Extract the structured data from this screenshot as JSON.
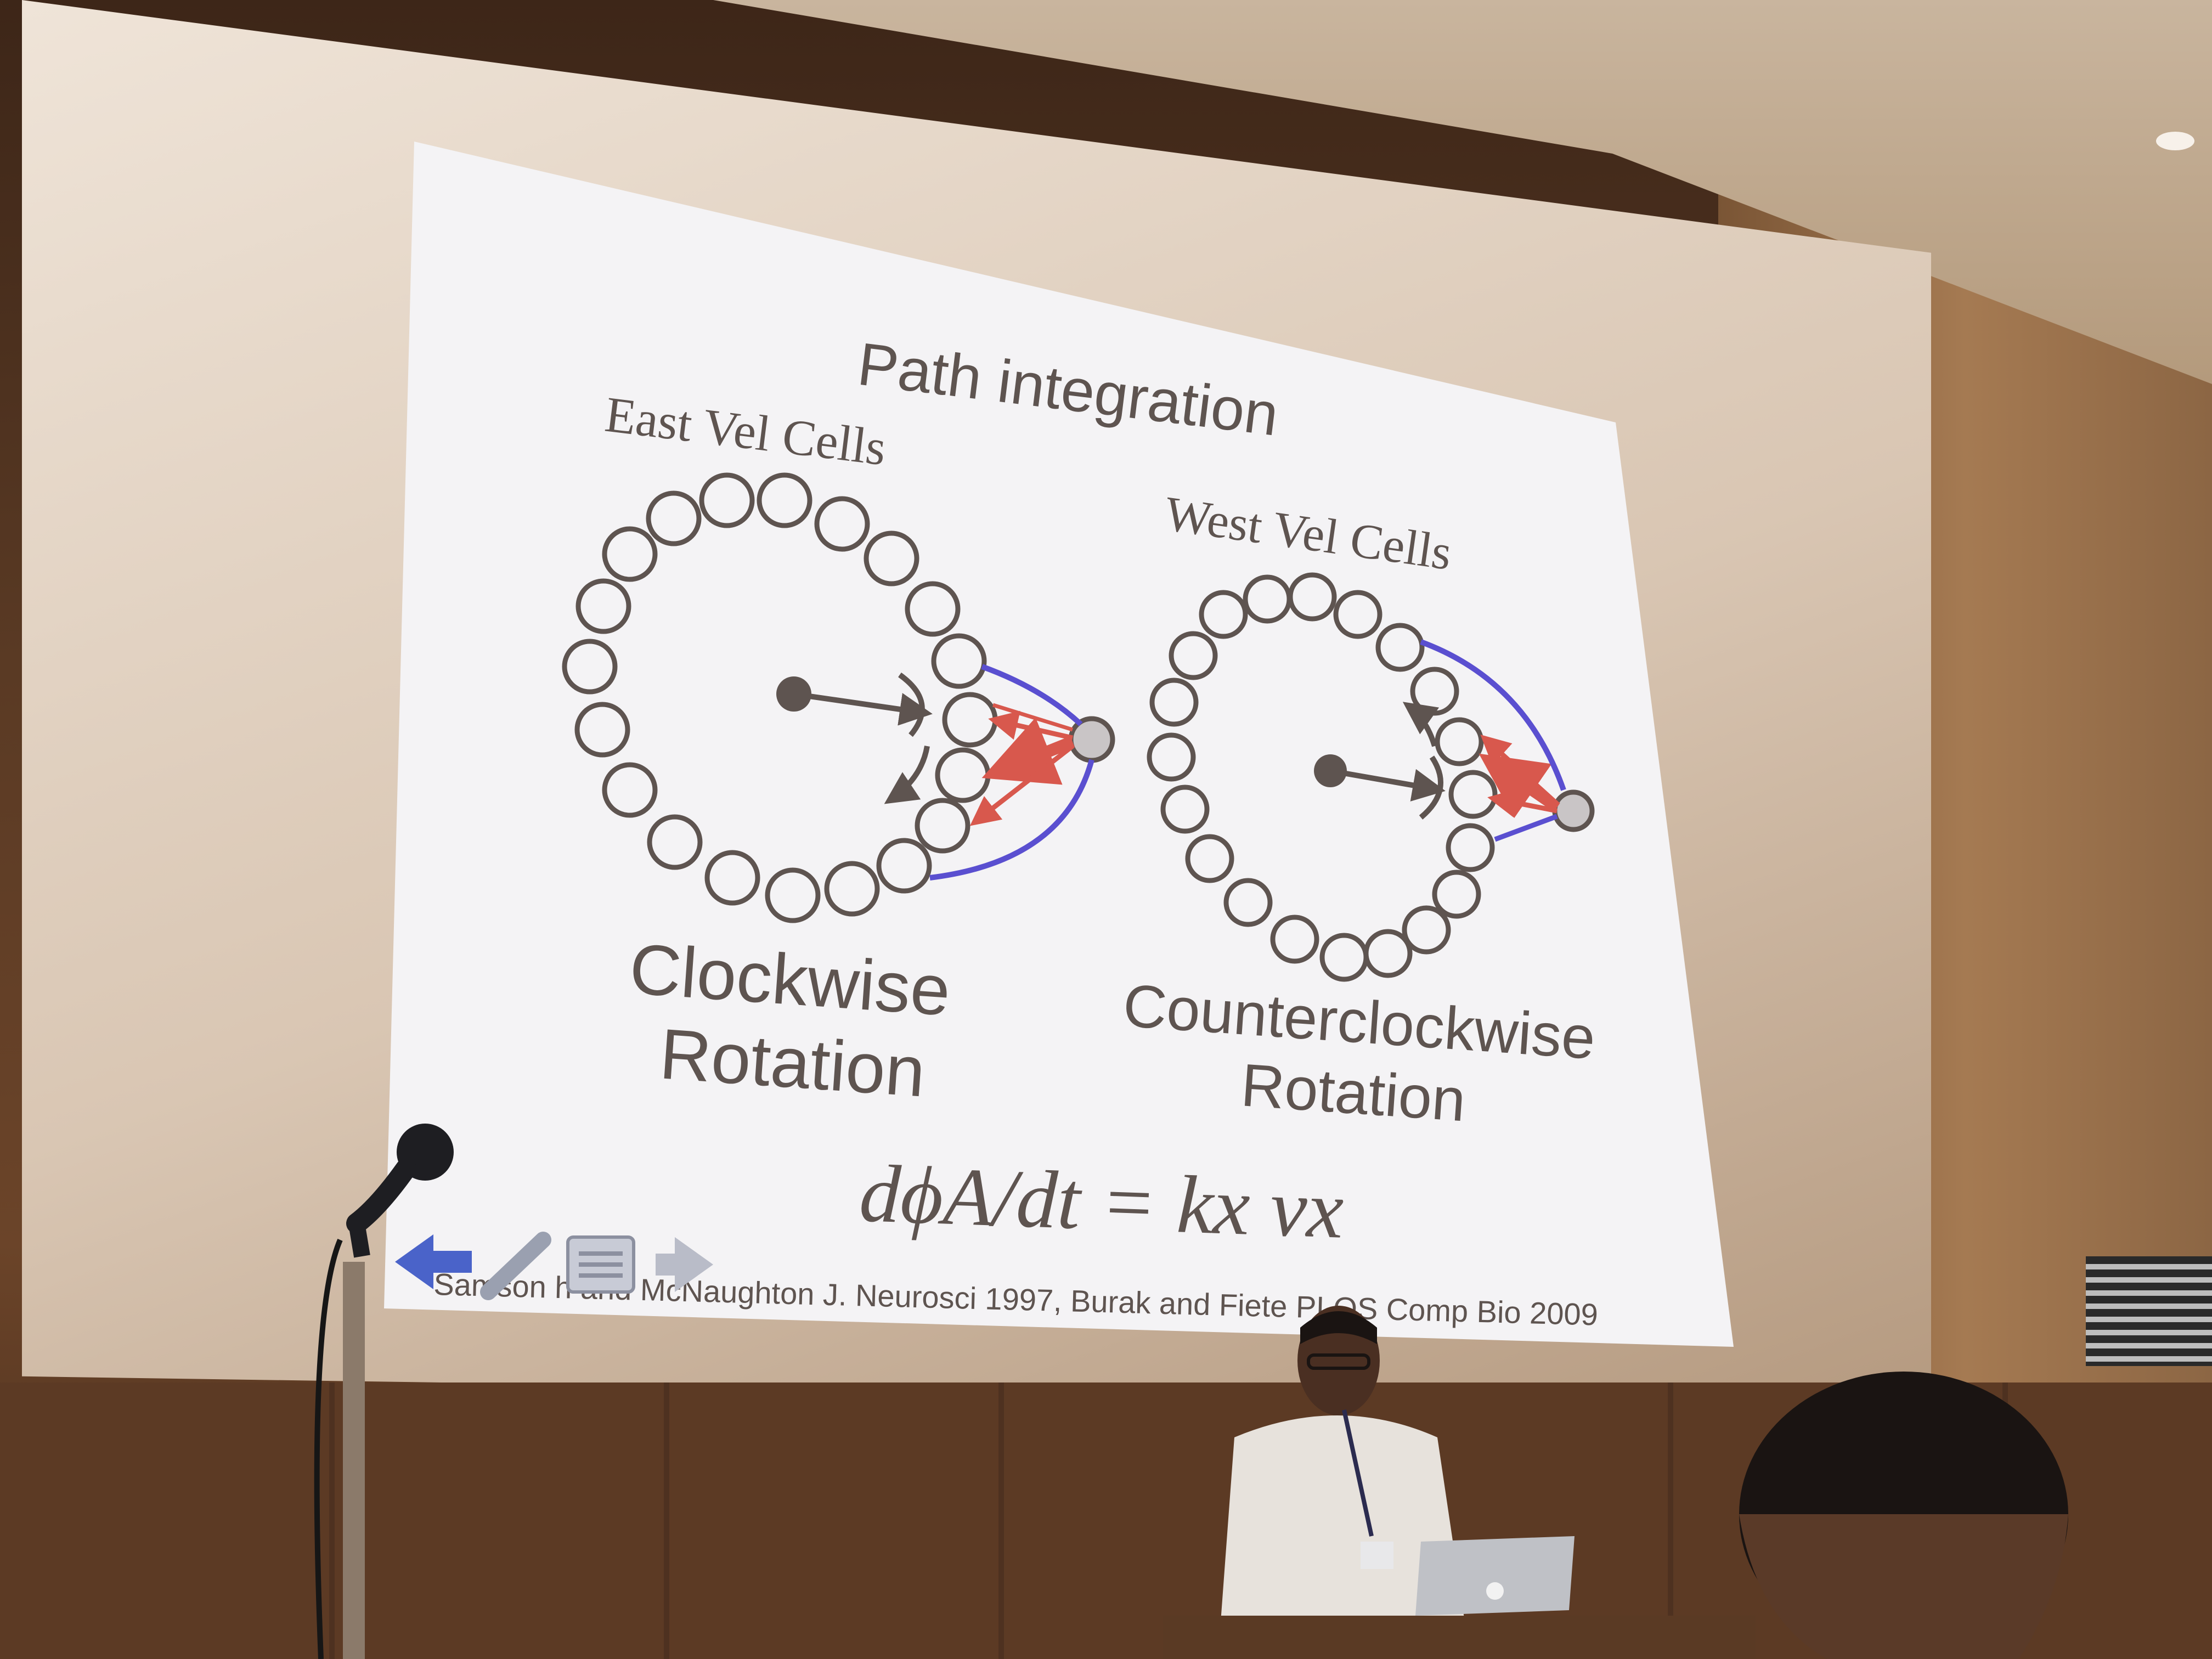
{
  "slide": {
    "title": "Path integration",
    "left_panel": {
      "cells_label": "East Vel Cells",
      "rotation_line1": "Clockwise",
      "rotation_line2": "Rotation"
    },
    "right_panel": {
      "cells_label": "West Vel Cells",
      "rotation_line1": "Counterclockwise",
      "rotation_line2": "Rotation"
    },
    "equation": "dϕA/dt = kx vx",
    "citation": "Samson     h and McNaughton J. Neurosci 1997,  Burak and Fiete  PLOS Comp Bio 2009"
  },
  "colors": {
    "slide_bg": "#f4f3f5",
    "text": "#5e5450",
    "inhibitory": "#5a4fd0",
    "excitatory": "#d8584d",
    "nav_arrow": "#4a63c9"
  },
  "icons": [
    "back-arrow-icon",
    "pen-icon",
    "menu-icon",
    "forward-arrow-icon",
    "apple-logo-icon"
  ]
}
